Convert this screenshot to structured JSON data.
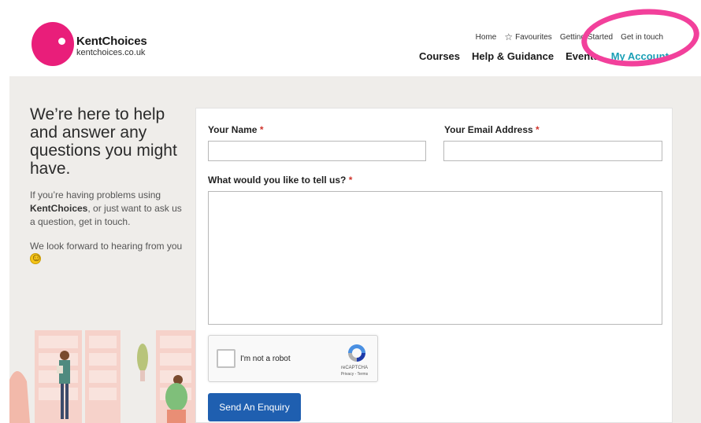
{
  "logo": {
    "title": "KentChoices",
    "subtitle": "kentchoices.co.uk",
    "brand_color": "#e91e7a"
  },
  "util_nav": {
    "home": "Home",
    "favourites": "Favourites",
    "favourites_icon": "star-icon",
    "getting_started": "Getting Started",
    "get_in_touch": "Get in touch"
  },
  "main_nav": {
    "courses": "Courses",
    "help": "Help & Guidance",
    "events": "Events",
    "account": "My Account",
    "account_color": "#1a9fb5"
  },
  "highlight_color": "#f2409b",
  "intro": {
    "heading": "We’re here to help and answer any questions you might have.",
    "p1_pre": "If you’re having problems using ",
    "p1_brand": "KentChoices",
    "p1_post": ", or just want to ask us a question, get in touch.",
    "p2": "We look forward to hearing from you",
    "smile_icon": "smiley-face-icon"
  },
  "form": {
    "name_label": "Your Name",
    "email_label": "Your Email Address",
    "message_label": "What would you like to tell us?",
    "required_mark": "*",
    "name_value": "",
    "email_value": "",
    "message_value": "",
    "recaptcha_label": "I'm not a robot",
    "recaptcha_brand": "reCAPTCHA",
    "recaptcha_links": "Privacy - Terms",
    "submit_label": "Send An Enquiry",
    "button_color": "#1f5fb0"
  }
}
